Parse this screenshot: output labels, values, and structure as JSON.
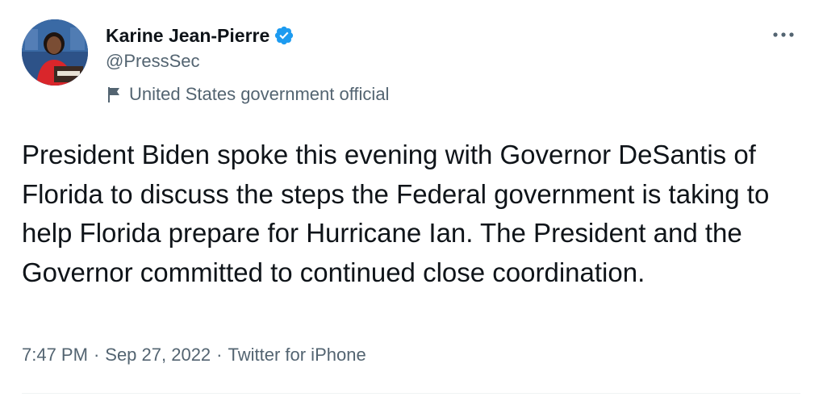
{
  "author": {
    "display_name": "Karine Jean-Pierre",
    "handle": "@PressSec",
    "verified": true,
    "label": "United States government official",
    "avatar_icon": "profile-photo"
  },
  "tweet": {
    "text": "President Biden spoke this evening with Governor DeSantis of Florida to discuss the steps the Federal government is taking to help Florida prepare for Hurricane Ian. The President and the Governor committed to continued close coordination.",
    "time": "7:47 PM",
    "date": "Sep 27, 2022",
    "source": "Twitter for iPhone",
    "separator": "·"
  },
  "icons": {
    "verified": "verified-badge-icon",
    "label": "flag-icon",
    "more": "more-options-icon"
  },
  "colors": {
    "text_primary": "#0f1419",
    "text_secondary": "#536471",
    "verified_blue": "#1d9bf0"
  }
}
